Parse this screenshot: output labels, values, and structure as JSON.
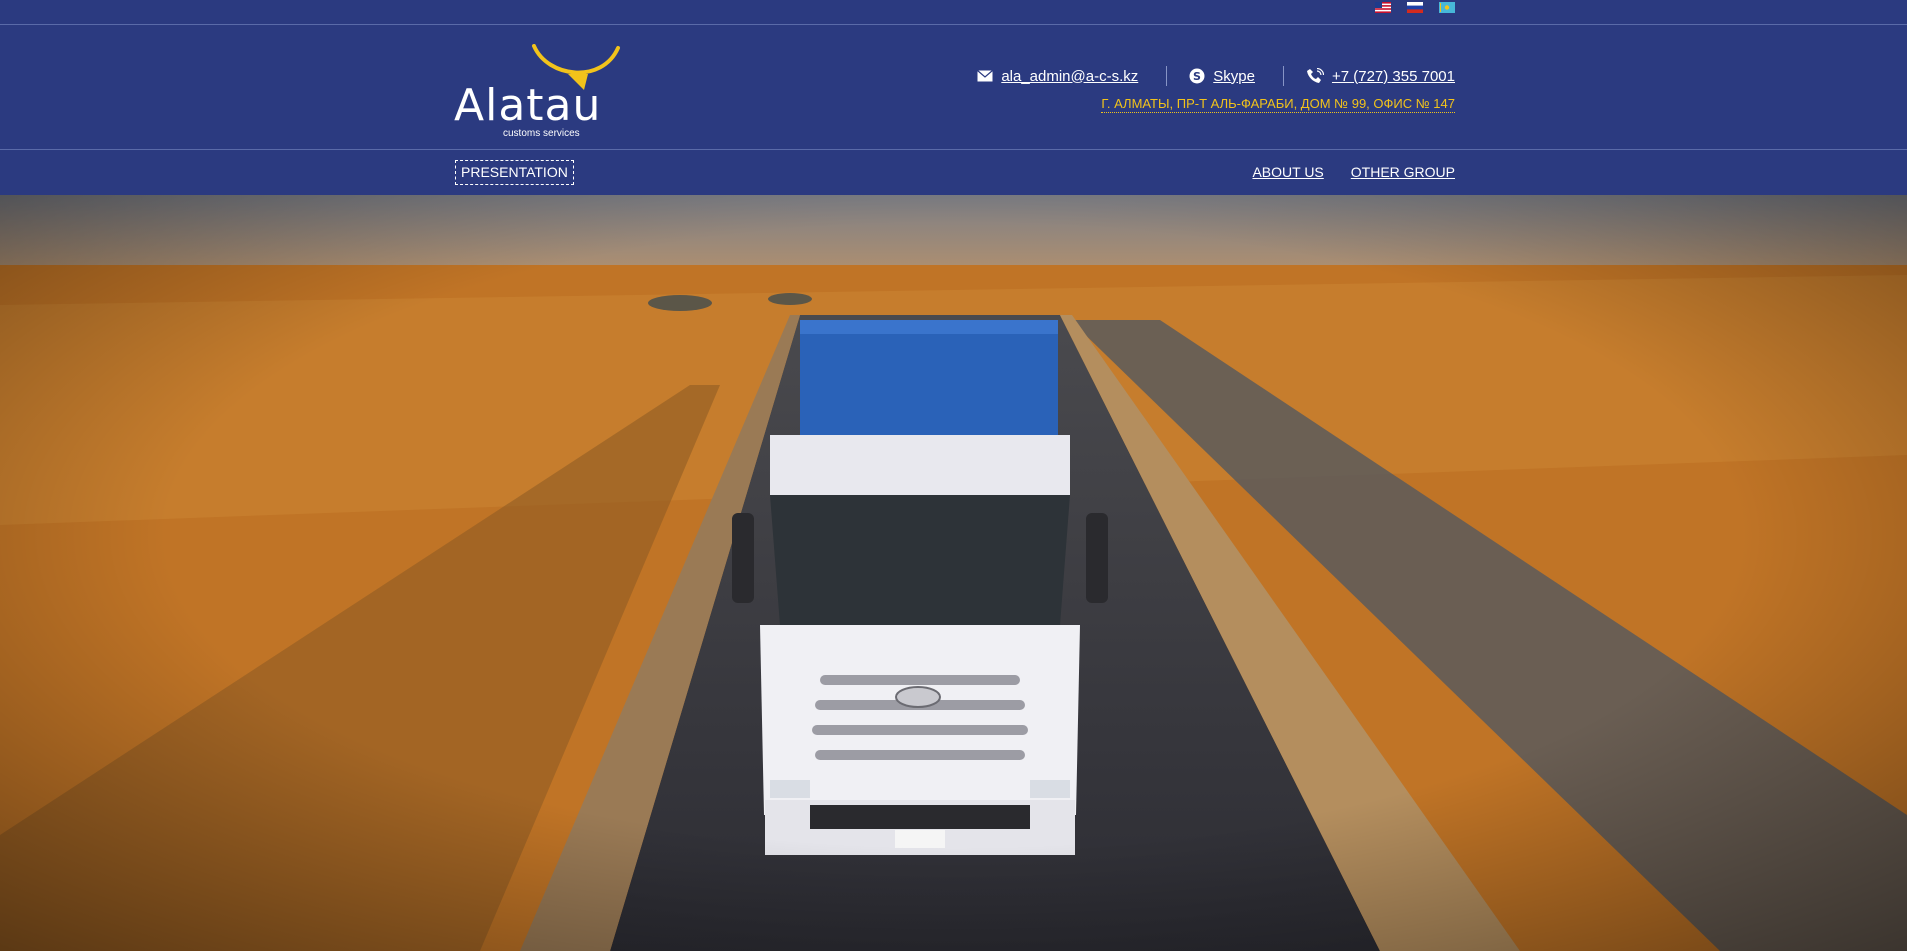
{
  "lang_bar": {
    "flags": [
      "flag-us-icon",
      "flag-ru-icon",
      "flag-kz-icon"
    ]
  },
  "header": {
    "logo": {
      "word": "Alatau",
      "subtitle": "customs services",
      "arc_color": "#f2c31b"
    },
    "contacts": {
      "email": "ala_admin@a-c-s.kz",
      "skype": "Skype",
      "phone": "+7 (727) 355 7001"
    },
    "address": "Г. АЛМАТЫ, ПР-Т АЛЬ-ФАРАБИ, ДОМ № 99, ОФИС № 147"
  },
  "nav": {
    "presentation": "PRESENTATION",
    "about": "ABOUT US",
    "other": "OTHER GROUP"
  },
  "hero": {
    "image": "truck-desert-hero-image"
  },
  "colors": {
    "background": "#2b3a80",
    "accent": "#f2c31b",
    "text": "#ffffff"
  }
}
